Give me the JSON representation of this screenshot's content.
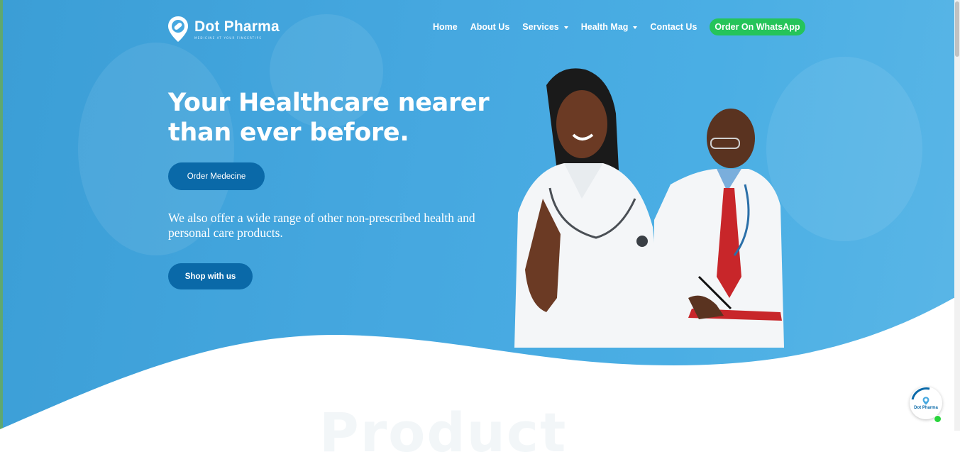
{
  "brand": {
    "name": "Dot Pharma",
    "tagline": "MEDICINE AT YOUR FINGERTIPS"
  },
  "nav": {
    "items": [
      {
        "label": "Home",
        "has_dropdown": false
      },
      {
        "label": "About Us",
        "has_dropdown": false
      },
      {
        "label": "Services",
        "has_dropdown": true
      },
      {
        "label": "Health Mag",
        "has_dropdown": true
      },
      {
        "label": "Contact Us",
        "has_dropdown": false
      }
    ],
    "cta_label": "Order On WhatsApp"
  },
  "hero": {
    "headline_line1": "Your Healthcare nearer",
    "headline_line2": "than ever before.",
    "order_button": "Order Medecine",
    "subcopy": "We also offer a wide range of other non-prescribed health and personal care products.",
    "shop_button": "Shop with us"
  },
  "section_heading_partial": "Product",
  "chat_widget": {
    "label": "Dot Pharma",
    "status": "online"
  },
  "colors": {
    "hero_blue": "#46a8e0",
    "button_blue": "#0a69a8",
    "whatsapp_green": "#25c45a",
    "status_green": "#28d43c"
  },
  "icons": [
    "logo-pin-icon",
    "chevron-down-icon",
    "chat-logo-icon"
  ]
}
